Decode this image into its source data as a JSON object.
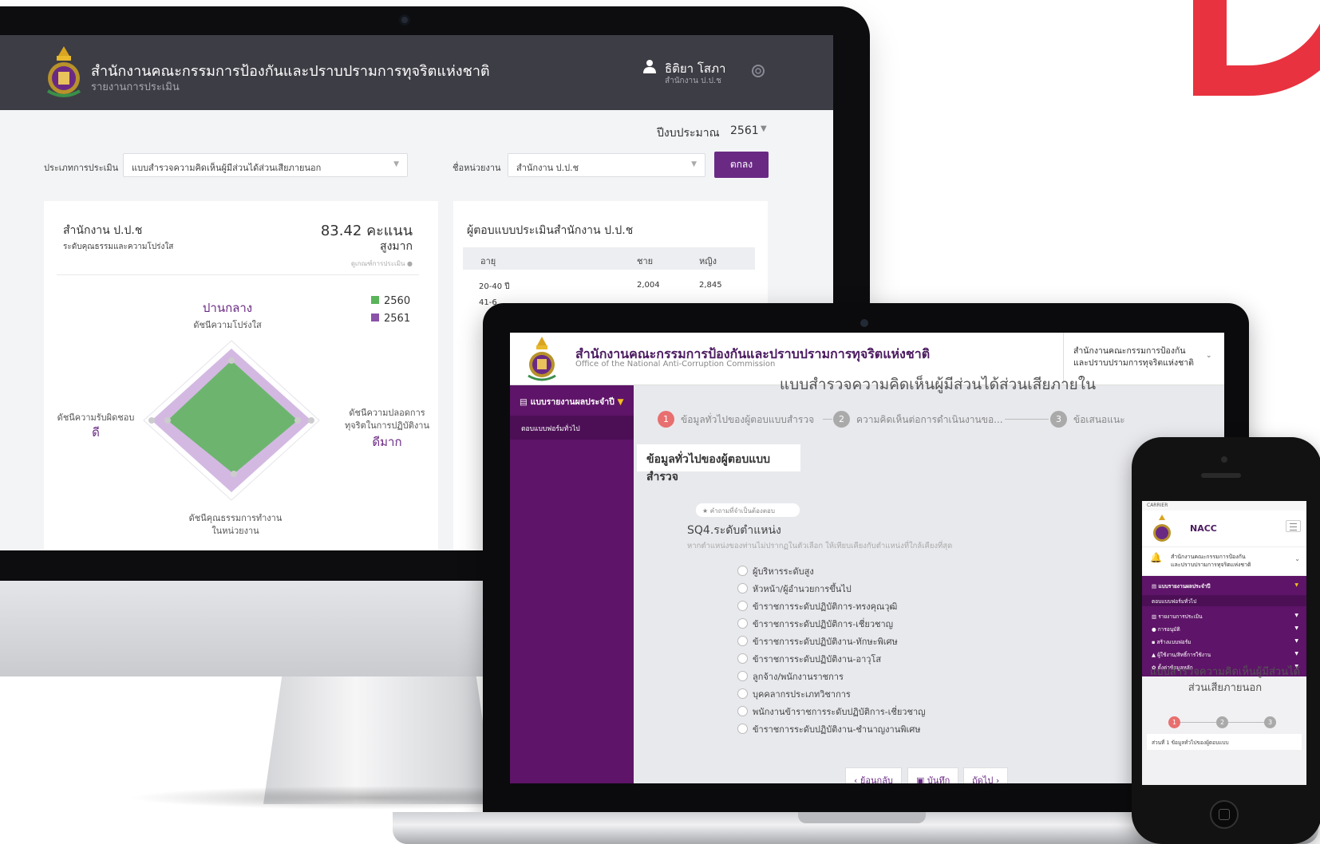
{
  "colors": {
    "brand_purple": "#5e1468",
    "accent_red": "#e8323f",
    "radar_2560": "#5ab45a",
    "radar_2561": "#b88bd2"
  },
  "imac": {
    "header": {
      "title": "สำนักงานคณะกรรมการป้องกันและปราบปรามการทุจริตแห่งชาติ",
      "subtitle": "รายงานการประเมิน",
      "user_name": "ธิติยา โสภา",
      "user_org": "สำนักงาน ป.ป.ช"
    },
    "filters": {
      "year_label": "ปีงบประมาณ",
      "year_value": "2561",
      "type_label": "ประเภทการประเมิน",
      "type_value": "แบบสำรวจความคิดเห็นผู้มีส่วนได้ส่วนเสียภายนอก",
      "unit_label": "ชื่อหน่วยงาน",
      "unit_value": "สำนักงาน ป.ป.ช",
      "ok_label": "ตกลง"
    },
    "score_card": {
      "org": "สำนักงาน ป.ป.ช",
      "desc": "ระดับคุณธรรมและความโปร่งใส",
      "score": "83.42 คะแนน",
      "level": "สูงมาก",
      "criteria_link": "ดูเกณฑ์การประเมิน",
      "legend": [
        "2560",
        "2561"
      ],
      "radar_top_value": "ปานกลาง",
      "radar_top_label": "ดัชนีความโปร่งใส",
      "radar_left_label": "ดัชนีความรับผิดชอบ",
      "radar_left_value": "ดี",
      "radar_right_label_1": "ดัชนีความปลอดการ",
      "radar_right_label_2": "ทุจริตในการปฏิบัติงาน",
      "radar_right_value": "ดีมาก",
      "radar_bottom_label_1": "ดัชนีคุณธรรมการทำงาน",
      "radar_bottom_label_2": "ในหน่วยงาน"
    },
    "respondents": {
      "title": "ผู้ตอบแบบประเมินสำนักงาน ป.ป.ช",
      "columns": [
        "อายุ",
        "ชาย",
        "หญิง"
      ],
      "rows": [
        {
          "age": "20-40 ปี",
          "male": "2,004",
          "female": "2,845"
        }
      ],
      "partial_row": "41-6"
    }
  },
  "laptop": {
    "header": {
      "title": "สำนักงานคณะกรรมการป้องกันและปราบปรามการทุจริตแห่งชาติ",
      "subtitle": "Office of the National Anti-Corruption Commission",
      "org_line1": "สำนักงานคณะกรรมการป้องกัน",
      "org_line2": "และปราบปรามการทุจริตแห่งชาติ"
    },
    "sidebar": {
      "head": "แบบรายงานผลประจำปี",
      "item": "ตอบแบบฟอร์มทั่วไป"
    },
    "form_title": "แบบสำรวจความคิดเห็นผู้มีส่วนได้ส่วนเสียภายใน",
    "steps": [
      {
        "num": "1",
        "label": "ข้อมูลทั่วไปของผู้ตอบแบบสำรวจ"
      },
      {
        "num": "2",
        "label": "ความคิดเห็นต่อการดำเนินงานขอ..."
      },
      {
        "num": "3",
        "label": "ข้อเสนอแนะ"
      }
    ],
    "section": "ข้อมูลทั่วไปของผู้ตอบแบบสำรวจ",
    "required_note": "คำถามที่จำเป็นต้องตอบ",
    "question": "SQ4.ระดับตำแหน่ง",
    "hint": "หากตำแหน่งของท่านไม่ปรากฏในตัวเลือก ให้เทียบเคียงกับตำแหน่งที่ใกล้เคียงที่สุด",
    "options": [
      "ผู้บริหารระดับสูง",
      "หัวหน้า/ผู้อำนวยการขึ้นไป",
      "ข้าราชการระดับปฏิบัติการ-ทรงคุณวุฒิ",
      "ข้าราชการระดับปฏิบัติการ-เชี่ยวชาญ",
      "ข้าราชการระดับปฏิบัติงาน-ทักษะพิเศษ",
      "ข้าราชการระดับปฏิบัติงาน-อาวุโส",
      "ลูกจ้าง/พนักงานราชการ",
      "บุคคลากรประเภทวิชาการ",
      "พนักงานข้าราชการระดับปฏิบัติการ-เชี่ยวชาญ",
      "ข้าราชการระดับปฏิบัติงาน-ชำนาญงานพิเศษ"
    ],
    "buttons": {
      "back": "ย้อนกลับ",
      "save": "บันทึก",
      "next": "ถัดไป"
    }
  },
  "phone": {
    "status": "CARRIER",
    "app_title": "NACC",
    "org_line1": "สำนักงานคณะกรรมการป้องกัน",
    "org_line2": "และปราบปรามการทุจริตแห่งชาติ",
    "menu": [
      "แบบรายงานผลประจำปี",
      "ตอบแบบฟอร์มทั่วไป",
      "รายงานการประเมิน",
      "การอนุมัติ",
      "สร้างแบบฟอร์ม",
      "ผู้ใช้งาน/สิทธิ์การใช้งาน",
      "ตั้งค่าข้อมูลหลัก"
    ],
    "form_title": "แบบสำรวจความคิดเห็นผู้มีส่วนได้ส่วนเสียภายนอก",
    "steps": [
      "1",
      "2",
      "3"
    ],
    "bottom_text": "ส่วนที่ 1 ข้อมูลทั่วไปของผู้ตอบแบบ"
  }
}
